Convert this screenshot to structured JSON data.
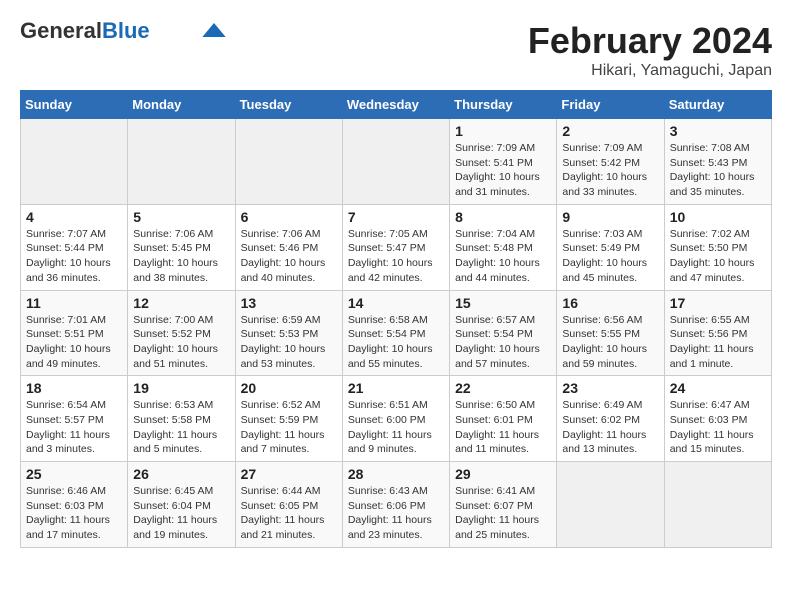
{
  "header": {
    "logo_general": "General",
    "logo_blue": "Blue",
    "month_year": "February 2024",
    "location": "Hikari, Yamaguchi, Japan"
  },
  "weekdays": [
    "Sunday",
    "Monday",
    "Tuesday",
    "Wednesday",
    "Thursday",
    "Friday",
    "Saturday"
  ],
  "weeks": [
    [
      {
        "day": "",
        "info": ""
      },
      {
        "day": "",
        "info": ""
      },
      {
        "day": "",
        "info": ""
      },
      {
        "day": "",
        "info": ""
      },
      {
        "day": "1",
        "info": "Sunrise: 7:09 AM\nSunset: 5:41 PM\nDaylight: 10 hours\nand 31 minutes."
      },
      {
        "day": "2",
        "info": "Sunrise: 7:09 AM\nSunset: 5:42 PM\nDaylight: 10 hours\nand 33 minutes."
      },
      {
        "day": "3",
        "info": "Sunrise: 7:08 AM\nSunset: 5:43 PM\nDaylight: 10 hours\nand 35 minutes."
      }
    ],
    [
      {
        "day": "4",
        "info": "Sunrise: 7:07 AM\nSunset: 5:44 PM\nDaylight: 10 hours\nand 36 minutes."
      },
      {
        "day": "5",
        "info": "Sunrise: 7:06 AM\nSunset: 5:45 PM\nDaylight: 10 hours\nand 38 minutes."
      },
      {
        "day": "6",
        "info": "Sunrise: 7:06 AM\nSunset: 5:46 PM\nDaylight: 10 hours\nand 40 minutes."
      },
      {
        "day": "7",
        "info": "Sunrise: 7:05 AM\nSunset: 5:47 PM\nDaylight: 10 hours\nand 42 minutes."
      },
      {
        "day": "8",
        "info": "Sunrise: 7:04 AM\nSunset: 5:48 PM\nDaylight: 10 hours\nand 44 minutes."
      },
      {
        "day": "9",
        "info": "Sunrise: 7:03 AM\nSunset: 5:49 PM\nDaylight: 10 hours\nand 45 minutes."
      },
      {
        "day": "10",
        "info": "Sunrise: 7:02 AM\nSunset: 5:50 PM\nDaylight: 10 hours\nand 47 minutes."
      }
    ],
    [
      {
        "day": "11",
        "info": "Sunrise: 7:01 AM\nSunset: 5:51 PM\nDaylight: 10 hours\nand 49 minutes."
      },
      {
        "day": "12",
        "info": "Sunrise: 7:00 AM\nSunset: 5:52 PM\nDaylight: 10 hours\nand 51 minutes."
      },
      {
        "day": "13",
        "info": "Sunrise: 6:59 AM\nSunset: 5:53 PM\nDaylight: 10 hours\nand 53 minutes."
      },
      {
        "day": "14",
        "info": "Sunrise: 6:58 AM\nSunset: 5:54 PM\nDaylight: 10 hours\nand 55 minutes."
      },
      {
        "day": "15",
        "info": "Sunrise: 6:57 AM\nSunset: 5:54 PM\nDaylight: 10 hours\nand 57 minutes."
      },
      {
        "day": "16",
        "info": "Sunrise: 6:56 AM\nSunset: 5:55 PM\nDaylight: 10 hours\nand 59 minutes."
      },
      {
        "day": "17",
        "info": "Sunrise: 6:55 AM\nSunset: 5:56 PM\nDaylight: 11 hours\nand 1 minute."
      }
    ],
    [
      {
        "day": "18",
        "info": "Sunrise: 6:54 AM\nSunset: 5:57 PM\nDaylight: 11 hours\nand 3 minutes."
      },
      {
        "day": "19",
        "info": "Sunrise: 6:53 AM\nSunset: 5:58 PM\nDaylight: 11 hours\nand 5 minutes."
      },
      {
        "day": "20",
        "info": "Sunrise: 6:52 AM\nSunset: 5:59 PM\nDaylight: 11 hours\nand 7 minutes."
      },
      {
        "day": "21",
        "info": "Sunrise: 6:51 AM\nSunset: 6:00 PM\nDaylight: 11 hours\nand 9 minutes."
      },
      {
        "day": "22",
        "info": "Sunrise: 6:50 AM\nSunset: 6:01 PM\nDaylight: 11 hours\nand 11 minutes."
      },
      {
        "day": "23",
        "info": "Sunrise: 6:49 AM\nSunset: 6:02 PM\nDaylight: 11 hours\nand 13 minutes."
      },
      {
        "day": "24",
        "info": "Sunrise: 6:47 AM\nSunset: 6:03 PM\nDaylight: 11 hours\nand 15 minutes."
      }
    ],
    [
      {
        "day": "25",
        "info": "Sunrise: 6:46 AM\nSunset: 6:03 PM\nDaylight: 11 hours\nand 17 minutes."
      },
      {
        "day": "26",
        "info": "Sunrise: 6:45 AM\nSunset: 6:04 PM\nDaylight: 11 hours\nand 19 minutes."
      },
      {
        "day": "27",
        "info": "Sunrise: 6:44 AM\nSunset: 6:05 PM\nDaylight: 11 hours\nand 21 minutes."
      },
      {
        "day": "28",
        "info": "Sunrise: 6:43 AM\nSunset: 6:06 PM\nDaylight: 11 hours\nand 23 minutes."
      },
      {
        "day": "29",
        "info": "Sunrise: 6:41 AM\nSunset: 6:07 PM\nDaylight: 11 hours\nand 25 minutes."
      },
      {
        "day": "",
        "info": ""
      },
      {
        "day": "",
        "info": ""
      }
    ]
  ]
}
